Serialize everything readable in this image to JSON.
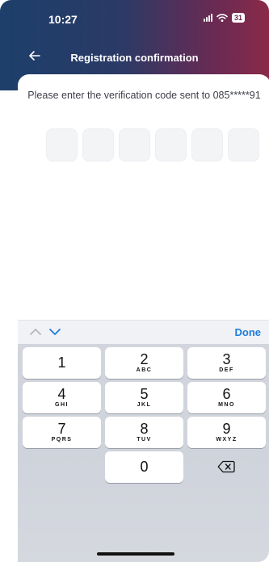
{
  "status_bar": {
    "time": "10:27",
    "battery": "31"
  },
  "nav": {
    "title": "Registration confirmation",
    "back_icon": "arrow-left-icon"
  },
  "verification": {
    "prompt": "Please enter the verification code sent to 085*****91",
    "code_length": 6
  },
  "keyboard": {
    "done_label": "Done",
    "keys": [
      {
        "num": "1",
        "letters": ""
      },
      {
        "num": "2",
        "letters": "ABC"
      },
      {
        "num": "3",
        "letters": "DEF"
      },
      {
        "num": "4",
        "letters": "GHI"
      },
      {
        "num": "5",
        "letters": "JKL"
      },
      {
        "num": "6",
        "letters": "MNO"
      },
      {
        "num": "7",
        "letters": "PQRS"
      },
      {
        "num": "8",
        "letters": "TUV"
      },
      {
        "num": "9",
        "letters": "WXYZ"
      },
      {
        "num": "0",
        "letters": ""
      }
    ],
    "delete_icon": "backspace-icon"
  },
  "colors": {
    "header_start": "#1d3f6b",
    "header_end": "#8a2a48",
    "accent": "#1e7ddb"
  }
}
